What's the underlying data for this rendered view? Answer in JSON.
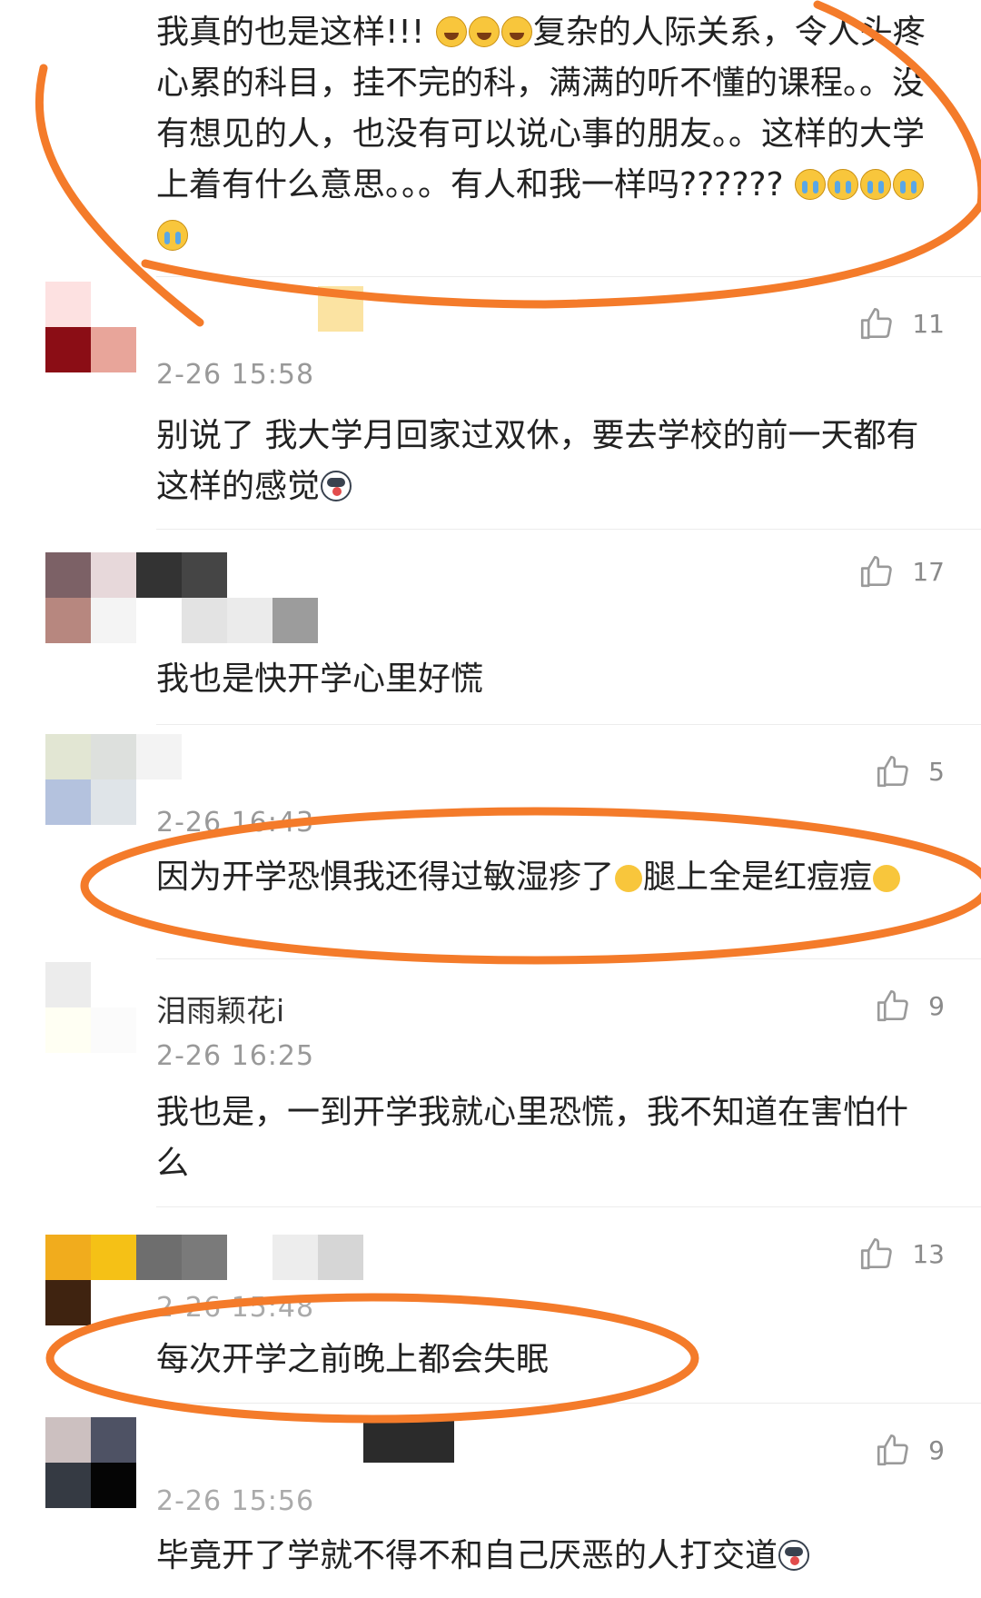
{
  "comments": [
    {
      "body": "我真的也是这样!!! ",
      "body2": "复杂的人际关系，令人头疼心累的科目，挂不完的科，满满的听不懂的课程。。没有想见的人，也没有可以说心事的朋友。。这样的大学上着有什么意思。。。有人和我一样吗?????? "
    },
    {
      "time": "2-26 15:58",
      "like_count": "11",
      "body": "别说了 我大学月回家过双休，要去学校的前一天都有这样的感觉"
    },
    {
      "like_count": "17",
      "body": "我也是快开学心里好慌"
    },
    {
      "time": "2-26 16:43",
      "like_count": "5",
      "body": "因为开学恐惧我还得过敏湿疹了",
      "body2": "腿上全是红痘痘"
    },
    {
      "nickname": "泪雨颖花i",
      "time": "2-26 16:25",
      "like_count": "9",
      "body": "我也是，一到开学我就心里恐慌，我不知道在害怕什么"
    },
    {
      "time": "2-26 15:48",
      "like_count": "13",
      "body": "每次开学之前晚上都会失眠"
    },
    {
      "time": "2-26 15:56",
      "like_count": "9",
      "body": "毕竟开了学就不得不和自己厌恶的人打交道"
    }
  ],
  "icons": {
    "like": "thumbs-up-icon",
    "emoji_laugh": "laughing-tears-emoji-icon",
    "emoji_cry": "crying-emoji-icon",
    "emoji_dog": "husky-emoji-icon",
    "emoji_smirk": "smirk-emoji-icon"
  },
  "colors": {
    "annotation": "#f47b2a",
    "like_icon": "#9a9a9a"
  }
}
